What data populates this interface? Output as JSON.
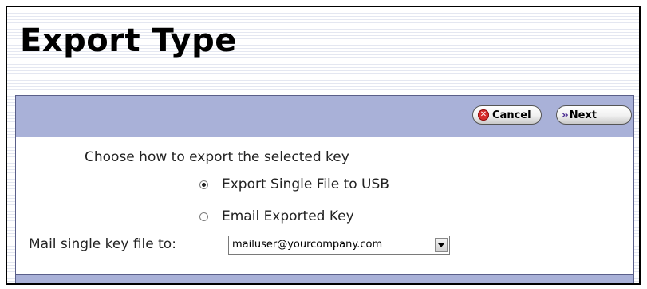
{
  "page": {
    "title": "Export Type"
  },
  "toolbar": {
    "cancel_label": "Cancel",
    "next_label": "Next"
  },
  "form": {
    "prompt": "Choose how to export the selected key",
    "options": [
      {
        "label": "Export Single File to USB",
        "selected": true
      },
      {
        "label": "Email Exported Key",
        "selected": false
      }
    ],
    "mail_label": "Mail single key file to:",
    "mail_value": "mailuser@yourcompany.com"
  },
  "icons": {
    "cancel": "cancel-x-icon",
    "next": "next-chevrons-icon",
    "dropdown": "dropdown-arrow-icon"
  },
  "colors": {
    "panel_bar": "#a9b1d8",
    "cancel_icon": "#d62b2b",
    "next_icon": "#4b2c91"
  }
}
